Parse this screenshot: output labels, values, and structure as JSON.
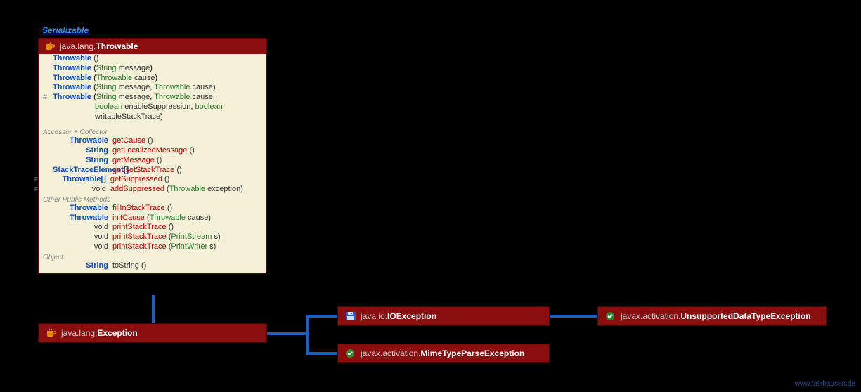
{
  "interface": "Serializable",
  "throwable": {
    "pkg": "java.lang.",
    "name": "Throwable",
    "constructors": [
      {
        "vis": "",
        "name": "Throwable",
        "params": "()"
      },
      {
        "vis": "",
        "name": "Throwable",
        "params_html": "(<span class='param-type'>String</span> <span class='param-name'>message</span>)"
      },
      {
        "vis": "",
        "name": "Throwable",
        "params_html": "(<span class='param-type'>Throwable</span> <span class='param-name'>cause</span>)"
      },
      {
        "vis": "",
        "name": "Throwable",
        "params_html": "(<span class='param-type'>String</span> <span class='param-name'>message</span>, <span class='param-type'>Throwable</span> <span class='param-name'>cause</span>)"
      },
      {
        "vis": "#",
        "name": "Throwable",
        "params_html": "(<span class='param-type'>String</span> <span class='param-name'>message</span>, <span class='param-type'>Throwable</span> <span class='param-name'>cause</span>,",
        "cont_html": "<span class='param-type'>boolean</span> <span class='param-name'>enableSuppression</span>, <span class='param-type'>boolean</span> <span class='param-name'>writableStackTrace</span>)"
      }
    ],
    "section_accessor": "Accessor + Collector",
    "accessors": [
      {
        "ret": "Throwable",
        "ret_class": "kw-type",
        "name": "getCause",
        "params": "()"
      },
      {
        "ret": "String",
        "ret_class": "kw-str",
        "name": "getLocalizedMessage",
        "params": "()"
      },
      {
        "ret": "String",
        "ret_class": "kw-str",
        "name": "getMessage",
        "params": "()"
      },
      {
        "ret": "StackTraceElement[]",
        "ret_class": "kw-type",
        "name": "get/setStackTrace",
        "params": "()"
      },
      {
        "ret": "Throwable[]",
        "ret_class": "kw-type",
        "name": "getSuppressed",
        "params": "()",
        "f": true
      },
      {
        "ret": "void",
        "ret_class": "plain",
        "name": "addSuppressed",
        "params_html": "(<span class='param-type'>Throwable</span> <span class='param-name'>exception</span>)",
        "f": true
      }
    ],
    "section_other": "Other Public Methods",
    "others": [
      {
        "ret": "Throwable",
        "ret_class": "kw-type",
        "name": "fillInStackTrace",
        "params": "()"
      },
      {
        "ret": "Throwable",
        "ret_class": "kw-type",
        "name": "initCause",
        "params_html": "(<span class='param-type'>Throwable</span> <span class='param-name'>cause</span>)"
      },
      {
        "ret": "void",
        "ret_class": "plain",
        "name": "printStackTrace",
        "params": "()"
      },
      {
        "ret": "void",
        "ret_class": "plain",
        "name": "printStackTrace",
        "params_html": "(<span class='param-type'>PrintStream</span> <span class='param-name'>s</span>)"
      },
      {
        "ret": "void",
        "ret_class": "plain",
        "name": "printStackTrace",
        "params_html": "(<span class='param-type'>PrintWriter</span> <span class='param-name'>s</span>)"
      }
    ],
    "section_object": "Object",
    "object_methods": [
      {
        "ret": "String",
        "ret_class": "kw-str",
        "name": "toString",
        "params": "()",
        "plain_name": true
      }
    ]
  },
  "exception": {
    "pkg": "java.lang.",
    "name": "Exception"
  },
  "ioexception": {
    "pkg": "java.io.",
    "name": "IOException"
  },
  "mimetype": {
    "pkg": "javax.activation.",
    "name": "MimeTypeParseException"
  },
  "unsupported": {
    "pkg": "javax.activation.",
    "name": "UnsupportedDataTypeException"
  },
  "watermark": "www.falkhausen.de"
}
